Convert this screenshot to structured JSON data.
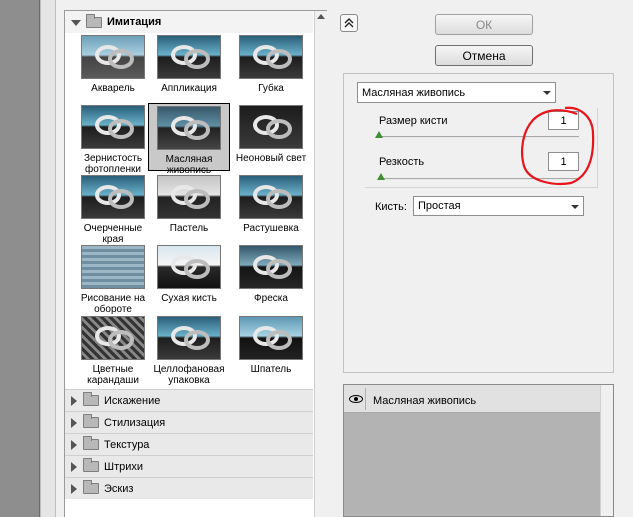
{
  "gallery": {
    "expanded_category": "Имитация",
    "thumbnails": [
      {
        "label": "Акварель",
        "style": "t-water"
      },
      {
        "label": "Аппликация",
        "style": ""
      },
      {
        "label": "Губка",
        "style": ""
      },
      {
        "label": "Зернистость фотопленки",
        "style": ""
      },
      {
        "label": "Масляная живопись",
        "style": "",
        "selected": true
      },
      {
        "label": "Неоновый свет",
        "style": "t-neon"
      },
      {
        "label": "Очерченные края",
        "style": ""
      },
      {
        "label": "Пастель",
        "style": "t-mono"
      },
      {
        "label": "Растушевка",
        "style": ""
      },
      {
        "label": "Рисование на обороте",
        "style": "t-wave"
      },
      {
        "label": "Сухая кисть",
        "style": "t-dry"
      },
      {
        "label": "Фреска",
        "style": "t-fresco"
      },
      {
        "label": "Цветные карандаши",
        "style": "t-cross"
      },
      {
        "label": "Целлофановая упаковка",
        "style": ""
      },
      {
        "label": "Шпатель",
        "style": "t-spat"
      }
    ],
    "categories": [
      "Искажение",
      "Стилизация",
      "Текстура",
      "Штрихи",
      "Эскиз"
    ]
  },
  "buttons": {
    "ok": "ОК",
    "cancel": "Отмена"
  },
  "settings": {
    "filter_name": "Масляная живопись",
    "brush_size_label": "Размер кисти",
    "brush_size_value": "1",
    "brush_size_level": 0,
    "sharpness_label": "Резкость",
    "sharpness_value": "1",
    "sharpness_level": 0.01,
    "brush_label": "Кисть:",
    "brush_type": "Простая"
  },
  "layers": {
    "active_layer": "Масляная живопись"
  },
  "colors": {
    "annotation_circle": "#e8141b",
    "slider_thumb": "#3e8f35"
  }
}
